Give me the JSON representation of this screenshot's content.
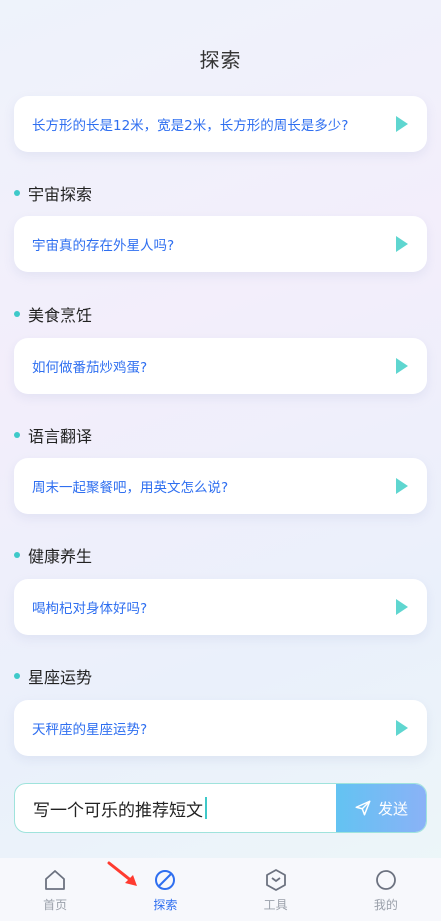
{
  "header": {
    "title": "探索"
  },
  "top_card": {
    "text": "长方形的长是12米，宽是2米，长方形的周长是多少?"
  },
  "sections": [
    {
      "title": "宇宙探索",
      "prompt": "宇宙真的存在外星人吗?"
    },
    {
      "title": "美食烹饪",
      "prompt": "如何做番茄炒鸡蛋?"
    },
    {
      "title": "语言翻译",
      "prompt": "周末一起聚餐吧，用英文怎么说?"
    },
    {
      "title": "健康养生",
      "prompt": "喝枸杞对身体好吗?"
    },
    {
      "title": "星座运势",
      "prompt": "天秤座的星座运势?"
    }
  ],
  "input": {
    "value": "写一个可乐的推荐短文",
    "send_label": "发送"
  },
  "tabs": [
    {
      "label": "首页",
      "icon": "home-icon",
      "active": false
    },
    {
      "label": "探索",
      "icon": "explore-icon",
      "active": true
    },
    {
      "label": "工具",
      "icon": "tools-icon",
      "active": false
    },
    {
      "label": "我的",
      "icon": "profile-icon",
      "active": false
    }
  ],
  "colors": {
    "accent": "#3ec9c9",
    "link": "#2f6ff0",
    "annotation_arrow": "#ff3b30"
  }
}
